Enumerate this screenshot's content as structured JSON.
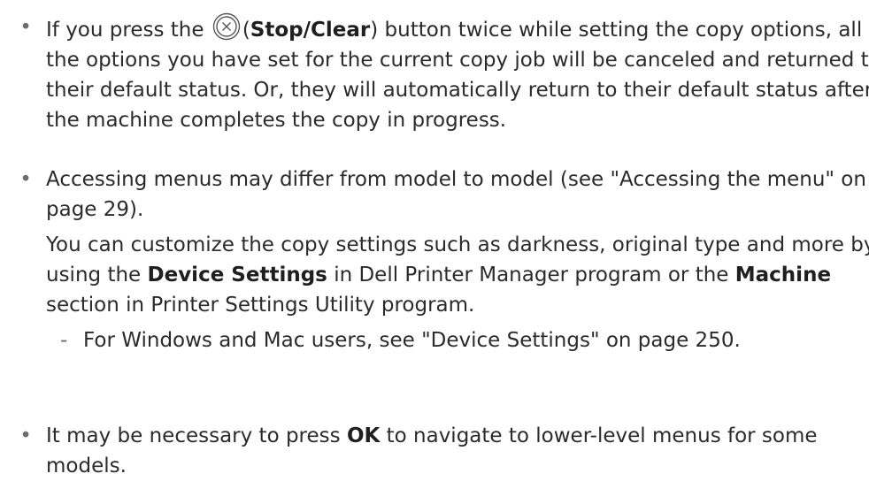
{
  "bullets": {
    "glyph": "•",
    "dash": "-",
    "b1": {
      "pre": "If you press the",
      "icon": "stop-clear-icon",
      "paren_open": "(",
      "bold": "Stop/Clear",
      "post": ") button twice while setting the copy options, all of the options you have set for the current copy job will be canceled and returned to their default status. Or, they will automatically return to their default status after the machine completes the copy in progress."
    },
    "b2": {
      "text": "Accessing menus may differ from model to model (see \"Accessing the menu\" on page 29).",
      "p2_pre": "You can customize the copy settings such as darkness, original type and more by using the",
      "p2_bold1": "Device Settings",
      "p2_mid": "in Dell Printer Manager program or the",
      "p2_bold2": "Machine",
      "p2_post": "section in Printer Settings Utility program.",
      "sub_item": "For Windows and Mac users, see \"Device Settings\" on page 250."
    },
    "b3": {
      "pre": "It may be necessary to press",
      "bold": "OK",
      "post": "to navigate to lower-level menus for some models."
    }
  }
}
